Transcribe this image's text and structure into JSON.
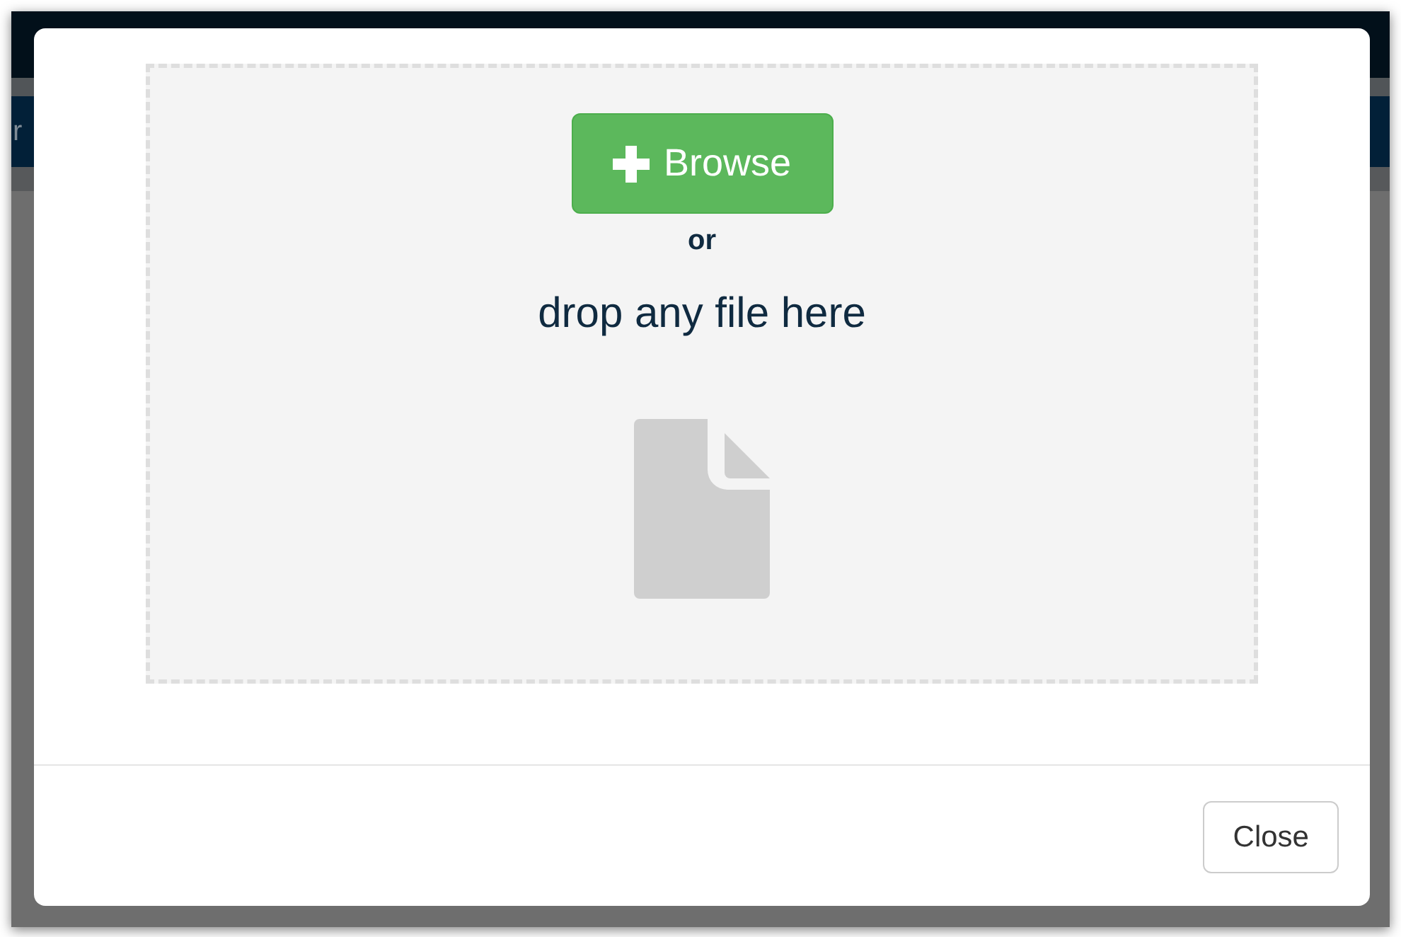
{
  "background": {
    "nav_fragment": "r"
  },
  "dialog": {
    "browse_button": "Browse",
    "separator": "or",
    "drop_hint": "drop any file here",
    "buttons": [
      "Close"
    ]
  }
}
